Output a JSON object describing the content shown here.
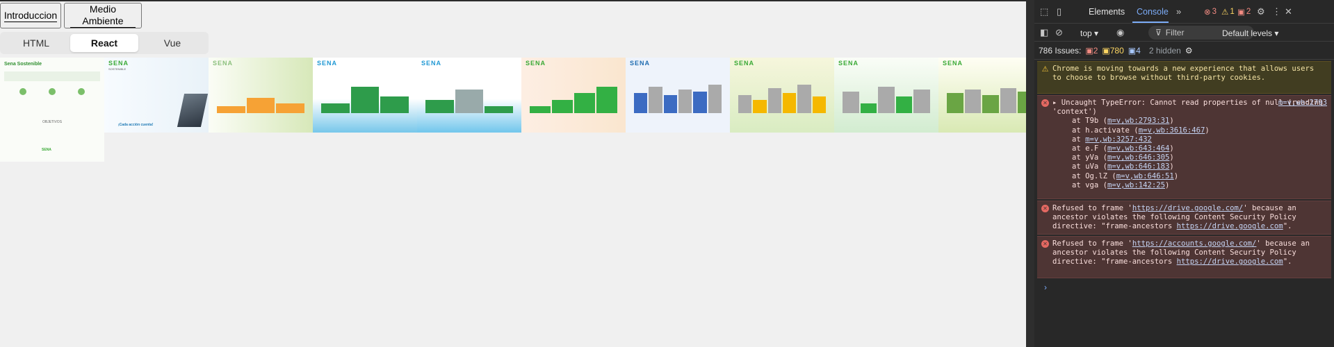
{
  "buttons": {
    "intro": "Introduccion",
    "env": "Medio Ambiente"
  },
  "tabs": [
    {
      "label": "HTML"
    },
    {
      "label": "React",
      "active": true
    },
    {
      "label": "Vue"
    }
  ],
  "slides": [
    {
      "title": "",
      "sub": ""
    },
    {
      "title": "SENA",
      "sub": "SOSTENIBLE",
      "caption": "¡Cada acción cuenta!"
    },
    {
      "title": "SENA",
      "sub": "SOSTENIBLE"
    },
    {
      "title": "SENA",
      "sub": "SOSTENIBLE"
    },
    {
      "title": "SENA",
      "sub": "SOSTENIBLE"
    },
    {
      "title": "SENA",
      "sub": "SOSTENIBLE"
    },
    {
      "title": "SENA",
      "sub": "SOSTENIBLE"
    },
    {
      "title": "SENA",
      "sub": "SOSTENIBLE"
    },
    {
      "title": "SENA",
      "sub": "SOSTENIBLE"
    },
    {
      "title": "SENA",
      "sub": "SOSTENIBLE"
    }
  ],
  "first_slide": {
    "heading": "Sena Sostenible",
    "objetivos": "OBJETIVOS",
    "footer": "SENA"
  },
  "devtools": {
    "tabs": {
      "elements": "Elements",
      "console": "Console"
    },
    "badges": {
      "errors": "3",
      "warnings": "1",
      "issues": "2"
    },
    "context": "top",
    "filter_placeholder": "Filter",
    "levels": "Default levels",
    "issues_text": "786 Issues:",
    "issue_counts": {
      "errors": "2",
      "warnings": "780",
      "info": "4"
    },
    "hidden": "2 hidden",
    "messages": [
      {
        "type": "warn",
        "text": "Chrome is moving towards a new experience that allows users to choose to browse without third-party cookies."
      },
      {
        "type": "err",
        "text": "Uncaught TypeError: Cannot read properties of null (reading 'context')",
        "source": "m=v,wb:2793",
        "stack": [
          {
            "fn": "at T9b",
            "loc": "m=v,wb:2793:31"
          },
          {
            "fn": "at h.activate",
            "loc": "m=v,wb:3616:467"
          },
          {
            "fn": "at",
            "loc": "m=v,wb:3257:432"
          },
          {
            "fn": "at e.F",
            "loc": "m=v,wb:643:464"
          },
          {
            "fn": "at yVa",
            "loc": "m=v,wb:646:305"
          },
          {
            "fn": "at uVa",
            "loc": "m=v,wb:646:183"
          },
          {
            "fn": "at Og.lZ",
            "loc": "m=v,wb:646:51"
          },
          {
            "fn": "at vga",
            "loc": "m=v,wb:142:25"
          }
        ]
      },
      {
        "type": "err",
        "pre": "Refused to frame '",
        "url": "https://drive.google.com/",
        "post": "' because an ancestor violates the following Content Security Policy directive: \"frame-ancestors",
        "url2": "https://drive.google.com",
        "post2": "\"."
      },
      {
        "type": "err",
        "pre": "Refused to frame '",
        "url": "https://accounts.google.com/",
        "post": "' because an ancestor violates the following Content Security Policy directive: \"frame-ancestors",
        "url2": "https://drive.google.com",
        "post2": "\"."
      }
    ]
  },
  "colors": {
    "console_accent": "#7cacf8",
    "error": "#e46962",
    "warning": "#f0c13a",
    "sena_green": "#39a935"
  }
}
